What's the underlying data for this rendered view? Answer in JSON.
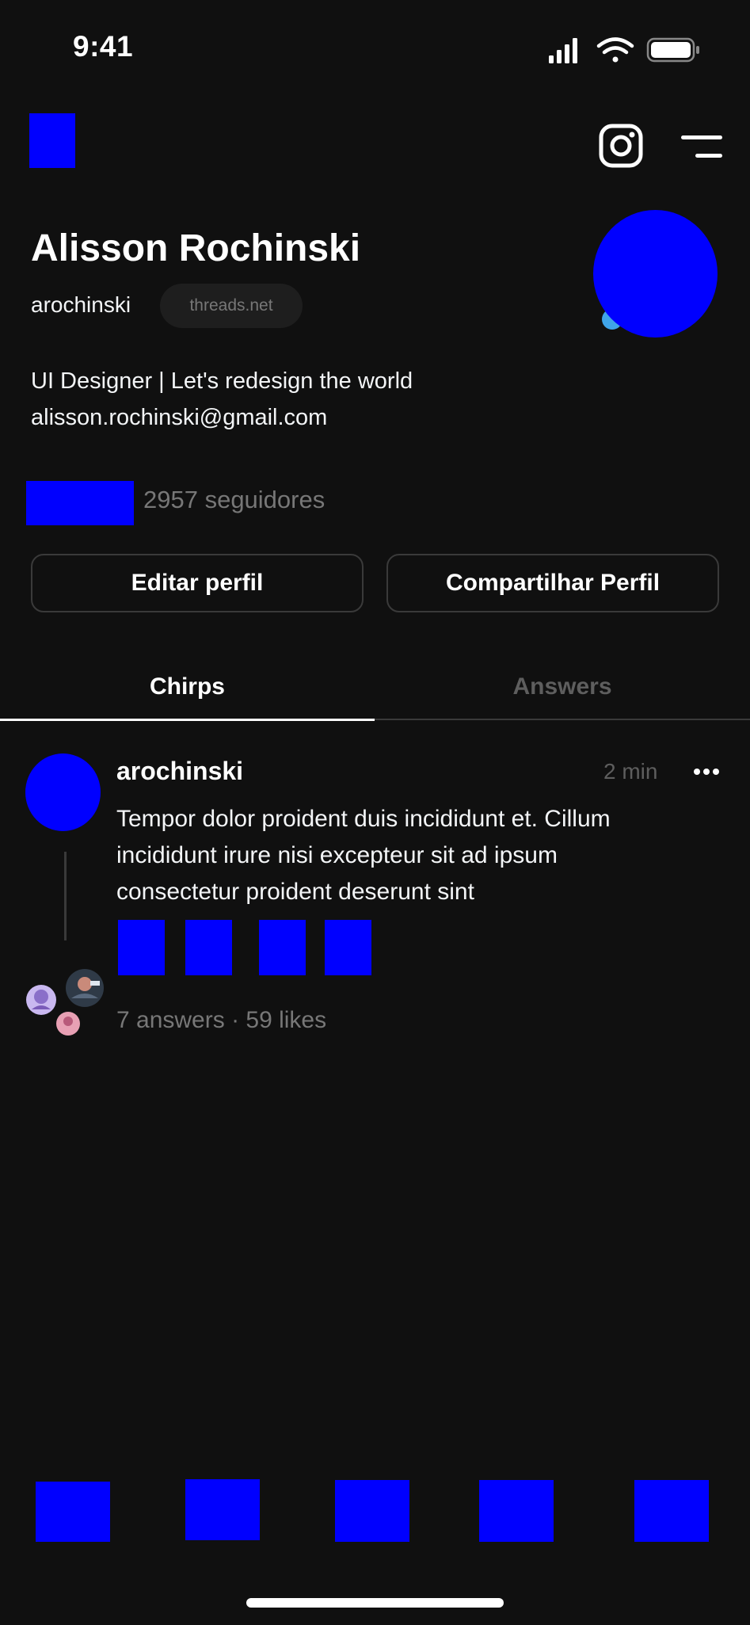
{
  "status_bar": {
    "time": "9:41",
    "icons": [
      "cellular-signal-icon",
      "wifi-icon",
      "battery-icon"
    ]
  },
  "header": {
    "icons": [
      "instagram-icon",
      "menu-icon"
    ]
  },
  "profile": {
    "name": "Alisson Rochinski",
    "username": "arochinski",
    "domain_pill": "threads.net",
    "bio_lines": [
      "UI Designer | Let's redesign the world",
      "alisson.rochinski@gmail.com"
    ],
    "followers_text": "2957 seguidores"
  },
  "buttons": {
    "edit_profile": "Editar perfil",
    "share_profile": "Compartilhar Perfil"
  },
  "tabs": [
    {
      "label": "Chirps",
      "active": true
    },
    {
      "label": "Answers",
      "active": false
    }
  ],
  "post": {
    "username": "arochinski",
    "time": "2 min",
    "text_lines": [
      "Tempor dolor proident duis incididunt et. Cillum",
      "incididunt irure nisi excepteur sit ad ipsum",
      "consectetur proident deserunt sint"
    ],
    "stats": "7 answers · 59 likes"
  },
  "colors": {
    "background": "#101010",
    "placeholder_blue": "#0000FF",
    "text_primary": "#F3F5F7",
    "text_secondary": "#777777",
    "border": "#3A3A3A"
  }
}
